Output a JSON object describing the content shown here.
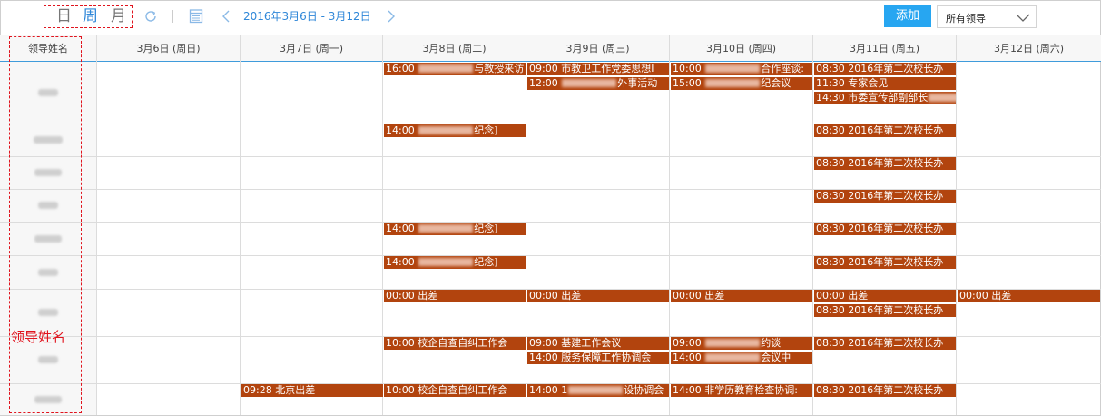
{
  "toolbar": {
    "views": [
      "日",
      "周",
      "月"
    ],
    "active_view": "周",
    "icons": [
      "refresh-icon",
      "calendar-icon",
      "chevron-left-icon",
      "chevron-right-icon",
      "chevron-down-icon"
    ],
    "date_range": "2016年3月6日 - 3月12日",
    "add_label": "添加",
    "leader_select": {
      "value": "所有领导"
    }
  },
  "grid": {
    "name_header": "领导姓名",
    "days": [
      "3月6日 (周日)",
      "3月7日 (周一)",
      "3月8日 (周二)",
      "3月9日 (周三)",
      "3月10日 (周四)",
      "3月11日 (周五)",
      "3月12日 (周六)"
    ]
  },
  "annotation": {
    "label": "领导姓名"
  },
  "colors": {
    "event_bg": "#b2440e",
    "accent": "#2f87d8",
    "add_bg": "#27a6f1",
    "annotation": "#e0141e"
  },
  "events": [
    {
      "row": 0,
      "col": 2,
      "slot": 0,
      "pre": "16:00 ",
      "blur": true,
      "post": "与教授来访"
    },
    {
      "row": 0,
      "col": 3,
      "slot": 0,
      "pre": "09:00  市教卫工作党委思想I",
      "blur": false,
      "post": ""
    },
    {
      "row": 0,
      "col": 3,
      "slot": 1,
      "pre": "12:00 ",
      "blur": true,
      "post": "外事活动"
    },
    {
      "row": 0,
      "col": 4,
      "slot": 0,
      "pre": "10:00 ",
      "blur": true,
      "post": "合作座谈:"
    },
    {
      "row": 0,
      "col": 4,
      "slot": 1,
      "pre": "15:00 ",
      "blur": true,
      "post": "纪会议"
    },
    {
      "row": 0,
      "col": 5,
      "slot": 0,
      "pre": "08:30  2016年第二次校长办",
      "blur": false,
      "post": ""
    },
    {
      "row": 0,
      "col": 5,
      "slot": 1,
      "pre": "11:30  专家会见",
      "blur": false,
      "post": ""
    },
    {
      "row": 0,
      "col": 5,
      "slot": 2,
      "pre": "14:30  市委宣传部副部长",
      "blur": true,
      "post": ""
    },
    {
      "row": 1,
      "col": 2,
      "slot": 0,
      "pre": "14:00 ",
      "blur": true,
      "post": "纪念]"
    },
    {
      "row": 1,
      "col": 5,
      "slot": 0,
      "pre": "08:30  2016年第二次校长办",
      "blur": false,
      "post": ""
    },
    {
      "row": 2,
      "col": 5,
      "slot": 0,
      "pre": "08:30  2016年第二次校长办",
      "blur": false,
      "post": ""
    },
    {
      "row": 3,
      "col": 5,
      "slot": 0,
      "pre": "08:30  2016年第二次校长办",
      "blur": false,
      "post": ""
    },
    {
      "row": 4,
      "col": 2,
      "slot": 0,
      "pre": "14:00 ",
      "blur": true,
      "post": "纪念]"
    },
    {
      "row": 4,
      "col": 5,
      "slot": 0,
      "pre": "08:30  2016年第二次校长办",
      "blur": false,
      "post": ""
    },
    {
      "row": 5,
      "col": 2,
      "slot": 0,
      "pre": "14:00 ",
      "blur": true,
      "post": "纪念]"
    },
    {
      "row": 5,
      "col": 5,
      "slot": 0,
      "pre": "08:30  2016年第二次校长办",
      "blur": false,
      "post": ""
    },
    {
      "row": 6,
      "col": 2,
      "slot": 0,
      "pre": "00:00  出差",
      "blur": false,
      "post": ""
    },
    {
      "row": 6,
      "col": 3,
      "slot": 0,
      "pre": "00:00  出差",
      "blur": false,
      "post": ""
    },
    {
      "row": 6,
      "col": 4,
      "slot": 0,
      "pre": "00:00  出差",
      "blur": false,
      "post": ""
    },
    {
      "row": 6,
      "col": 5,
      "slot": 0,
      "pre": "00:00  出差",
      "blur": false,
      "post": ""
    },
    {
      "row": 6,
      "col": 6,
      "slot": 0,
      "pre": "00:00  出差",
      "blur": false,
      "post": "",
      "wide": true
    },
    {
      "row": 6,
      "col": 5,
      "slot": 1,
      "pre": "08:30  2016年第二次校长办",
      "blur": false,
      "post": ""
    },
    {
      "row": 7,
      "col": 2,
      "slot": 0,
      "pre": "10:00  校企自查自纠工作会",
      "blur": false,
      "post": ""
    },
    {
      "row": 7,
      "col": 3,
      "slot": 0,
      "pre": "09:00  基建工作会议",
      "blur": false,
      "post": ""
    },
    {
      "row": 7,
      "col": 3,
      "slot": 1,
      "pre": "14:00  服务保障工作协调会",
      "blur": false,
      "post": ""
    },
    {
      "row": 7,
      "col": 4,
      "slot": 0,
      "pre": "09:00 ",
      "blur": true,
      "post": "约谈"
    },
    {
      "row": 7,
      "col": 4,
      "slot": 1,
      "pre": "14:00 ",
      "blur": true,
      "post": "会议中"
    },
    {
      "row": 7,
      "col": 5,
      "slot": 0,
      "pre": "08:30  2016年第二次校长办",
      "blur": false,
      "post": ""
    },
    {
      "row": 8,
      "col": 1,
      "slot": 0,
      "pre": "09:28  北京出差",
      "blur": false,
      "post": ""
    },
    {
      "row": 8,
      "col": 2,
      "slot": 0,
      "pre": "10:00  校企自查自纠工作会",
      "blur": false,
      "post": ""
    },
    {
      "row": 8,
      "col": 3,
      "slot": 0,
      "pre": "14:00  1",
      "blur": true,
      "post": "设协调会"
    },
    {
      "row": 8,
      "col": 4,
      "slot": 0,
      "pre": "14:00  非学历教育检查协调:",
      "blur": false,
      "post": ""
    },
    {
      "row": 8,
      "col": 5,
      "slot": 0,
      "pre": "08:30  2016年第二次校长办",
      "blur": false,
      "post": ""
    }
  ]
}
